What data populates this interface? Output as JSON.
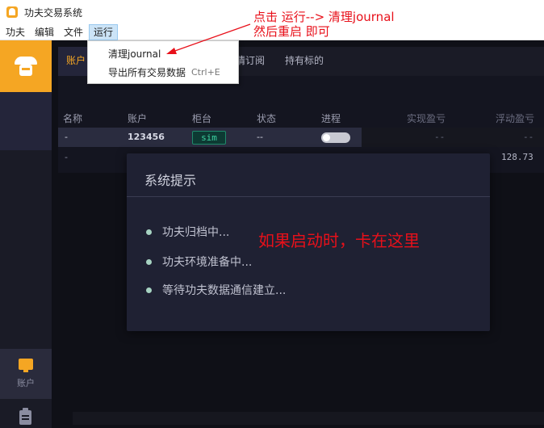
{
  "window": {
    "title": "功夫交易系统"
  },
  "menubar": {
    "items": [
      "功夫",
      "编辑",
      "文件",
      "运行"
    ]
  },
  "dropdown": {
    "items": [
      {
        "label": "清理journal",
        "shortcut": ""
      },
      {
        "label": "导出所有交易数据",
        "shortcut": "Ctrl+E"
      }
    ]
  },
  "tabs": {
    "account": "账户",
    "subscribe": "行情订阅",
    "holding": "持有标的"
  },
  "table": {
    "headers": [
      "名称",
      "账户",
      "柜台",
      "状态",
      "进程",
      "实现盈亏",
      "浮动盈亏"
    ],
    "row1": {
      "name": "-",
      "account": "123456",
      "counter": "sim",
      "status": "--",
      "realized": "--",
      "floating": "--"
    },
    "row2": {
      "name": "-",
      "value": "128.73"
    }
  },
  "sidebar": {
    "account_label": "账户"
  },
  "modal": {
    "title": "系统提示",
    "items": [
      "功夫归档中...",
      "功夫环境准备中...",
      "等待功夫数据通信建立..."
    ]
  },
  "annotations": {
    "line1": "点击 运行--> 清理journal",
    "line2": "然后重启 即可",
    "stuck": "如果启动时，卡在这里"
  },
  "colors": {
    "accent": "#f5a623",
    "annotation": "#e8101a",
    "badge_green": "#3ed3a3"
  }
}
